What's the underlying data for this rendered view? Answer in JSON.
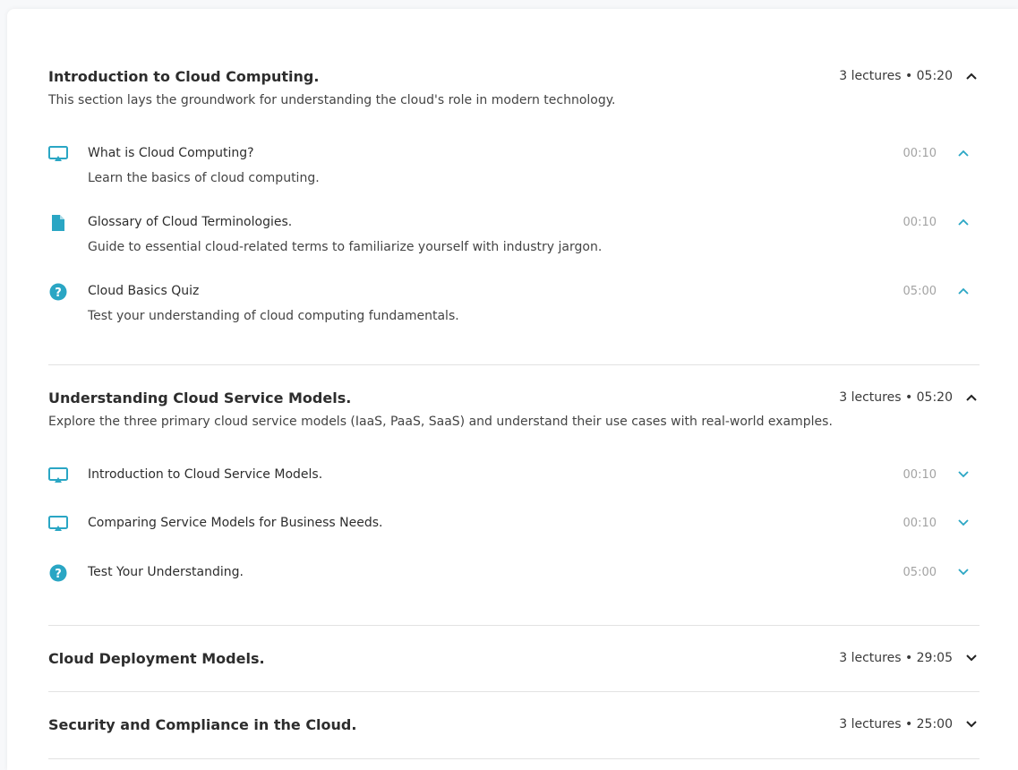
{
  "colors": {
    "accent": "#2aa6c4",
    "divider": "#e2e2e2"
  },
  "sections": [
    {
      "title": "Introduction to Cloud Computing.",
      "meta": "3 lectures • 05:20",
      "expanded": true,
      "description": "This section lays the groundwork for understanding the cloud's role in modern technology.",
      "lectures": [
        {
          "icon": "video-icon",
          "title": "What is Cloud Computing?",
          "time": "00:10",
          "expanded": true,
          "description": "Learn the basics of cloud computing."
        },
        {
          "icon": "document-icon",
          "title": "Glossary of Cloud Terminologies.",
          "time": "00:10",
          "expanded": true,
          "description": "Guide to essential cloud-related terms to familiarize yourself with industry jargon."
        },
        {
          "icon": "quiz-icon",
          "title": "Cloud Basics Quiz",
          "time": "05:00",
          "expanded": true,
          "description": "Test your understanding of cloud computing fundamentals."
        }
      ]
    },
    {
      "title": "Understanding Cloud Service Models.",
      "meta": "3 lectures • 05:20",
      "expanded": true,
      "description": "Explore the three primary cloud service models (IaaS, PaaS, SaaS) and understand their use cases with real-world examples.",
      "lectures": [
        {
          "icon": "video-icon",
          "title": "Introduction to Cloud Service Models.",
          "time": "00:10",
          "expanded": false
        },
        {
          "icon": "video-icon",
          "title": "Comparing Service Models for Business Needs.",
          "time": "00:10",
          "expanded": false
        },
        {
          "icon": "quiz-icon",
          "title": "Test Your Understanding.",
          "time": "05:00",
          "expanded": false
        }
      ]
    },
    {
      "title": "Cloud Deployment Models.",
      "meta": "3 lectures • 29:05",
      "expanded": false
    },
    {
      "title": "Security and Compliance in the Cloud.",
      "meta": "3 lectures • 25:00",
      "expanded": false
    }
  ]
}
